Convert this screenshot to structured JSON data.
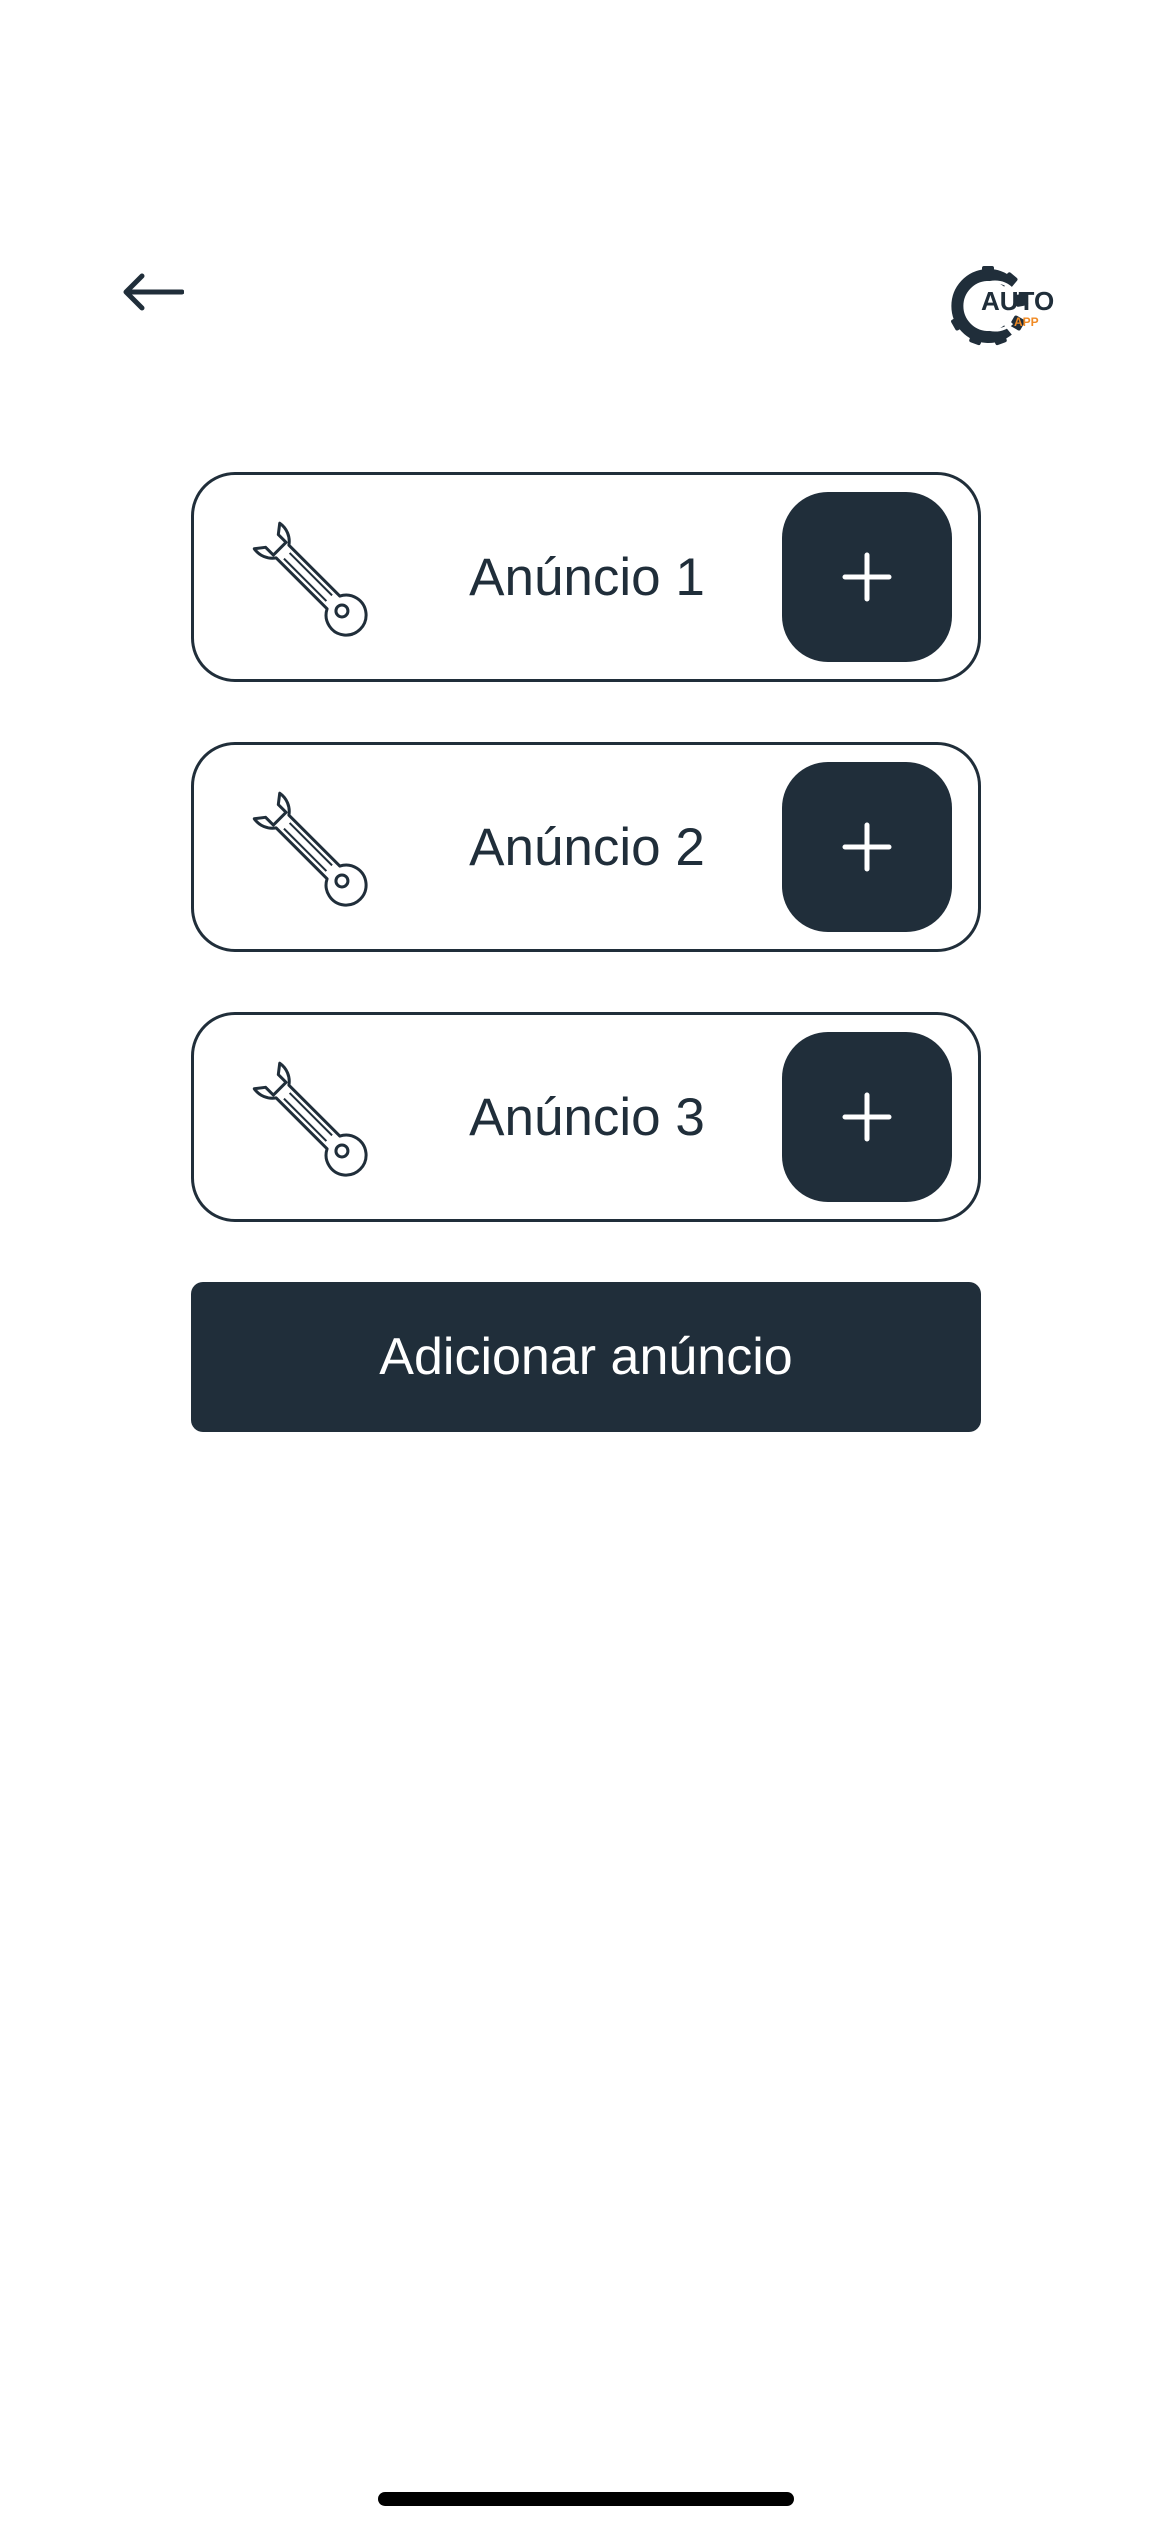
{
  "header": {
    "back_icon": "arrow-left-icon",
    "logo": {
      "icon": "gear-icon",
      "line1": "AUTO",
      "line2": "APP",
      "primary_color": "#202e3a",
      "accent_color": "#f08a24"
    }
  },
  "ads": [
    {
      "label": "Anúncio 1",
      "icon": "wrench-icon",
      "action_icon": "plus-icon"
    },
    {
      "label": "Anúncio 2",
      "icon": "wrench-icon",
      "action_icon": "plus-icon"
    },
    {
      "label": "Anúncio 3",
      "icon": "wrench-icon",
      "action_icon": "plus-icon"
    }
  ],
  "add_ad_button": {
    "label": "Adicionar anúncio"
  },
  "colors": {
    "primary": "#202e3a",
    "background": "#ffffff",
    "accent": "#f08a24"
  }
}
